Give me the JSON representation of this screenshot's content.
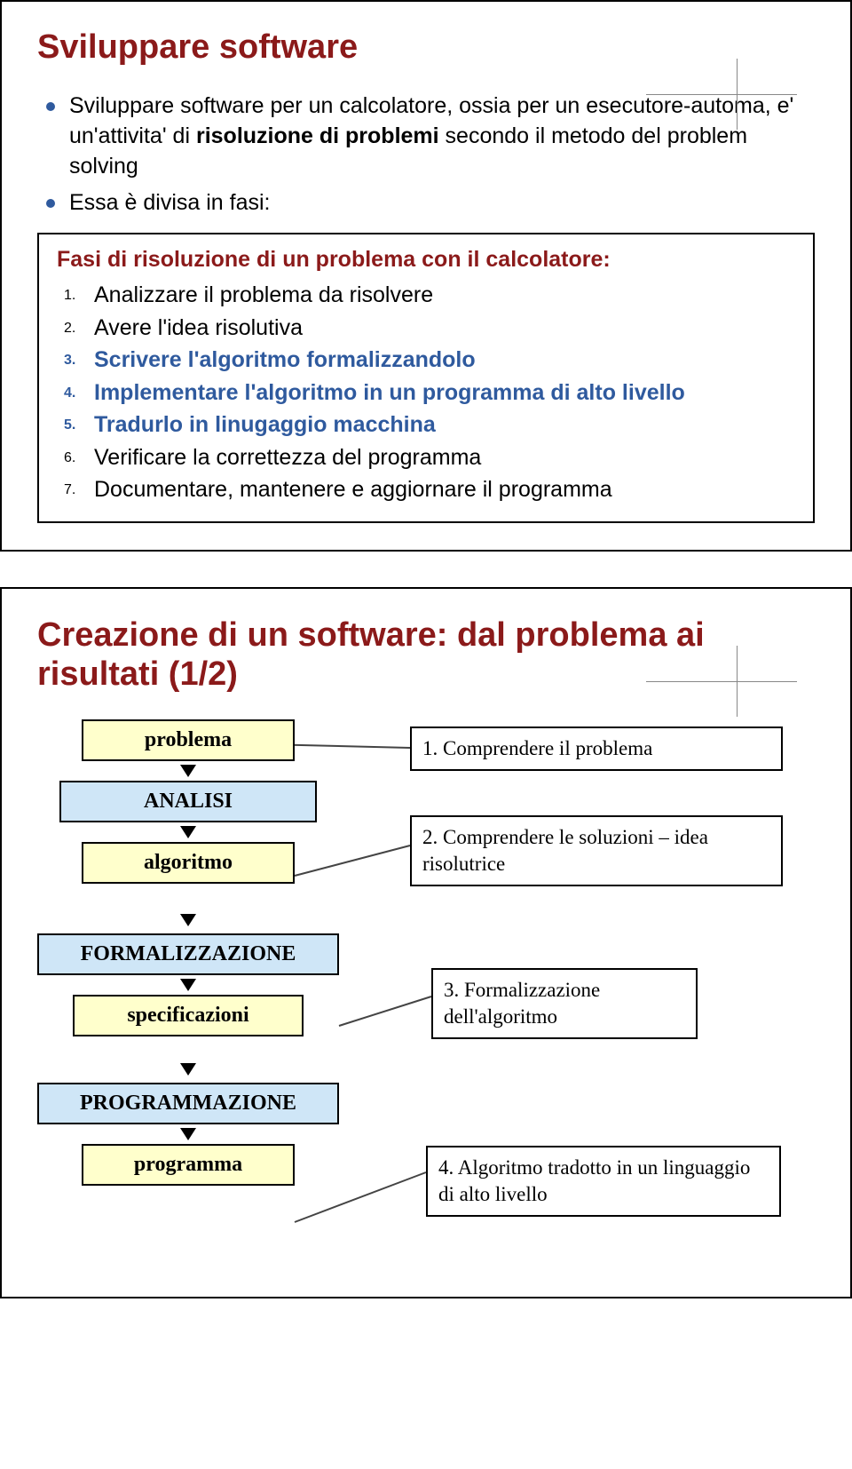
{
  "slide1": {
    "title": "Sviluppare software",
    "b1_pre": "Sviluppare software per un calcolatore, ossia per un esecutore-automa, e' un'attivita' di ",
    "b1_bold": "risoluzione di problemi",
    "b1_post": " secondo il metodo del problem solving",
    "b2": "Essa è divisa in fasi:",
    "inner_title": "Fasi di risoluzione di un problema con il calcolatore:",
    "items": {
      "n1_num": "1.",
      "n1_txt": "Analizzare il problema da risolvere",
      "n2_num": "2.",
      "n2_txt": "Avere l'idea risolutiva",
      "n3_num": "3.",
      "n3_txt": "Scrivere l'algoritmo formalizzandolo",
      "n4_num": "4.",
      "n4_txt": "Implementare l'algoritmo in un programma di alto livello",
      "n5_num": "5.",
      "n5_txt": "Tradurlo in linugaggio macchina",
      "n6_num": "6.",
      "n6_txt": "Verificare la correttezza del programma",
      "n7_num": "7.",
      "n7_txt": "Documentare, mantenere e aggiornare il programma"
    }
  },
  "slide2": {
    "title": "Creazione di un software: dal problema ai risultati (1/2)",
    "left": {
      "problema": "problema",
      "analisi": "ANALISI",
      "algoritmo": "algoritmo",
      "formalizzazione": "FORMALIZZAZIONE",
      "specificazioni": "specificazioni",
      "programmazione": "PROGRAMMAZIONE",
      "programma": "programma"
    },
    "right": {
      "r1": "1. Comprendere il problema",
      "r2": "2. Comprendere le soluzioni – idea risolutrice",
      "r3": "3. Formalizzazione dell'algoritmo",
      "r4": "4. Algoritmo tradotto in un linguaggio di alto livello"
    }
  }
}
